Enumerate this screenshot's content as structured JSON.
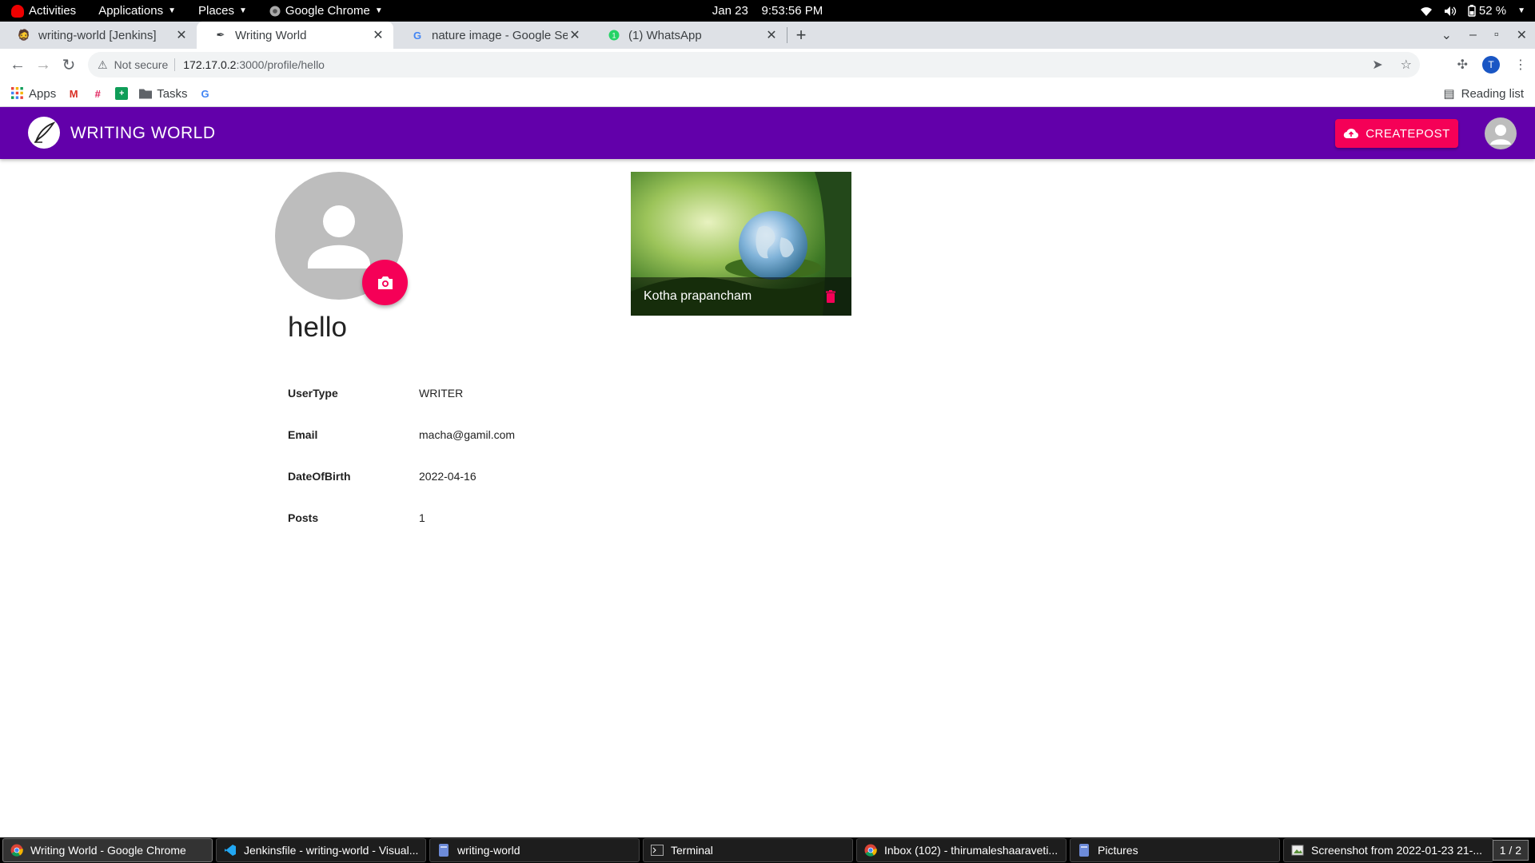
{
  "system_bar": {
    "activities": "Activities",
    "applications": "Applications",
    "places": "Places",
    "app_menu": "Google Chrome",
    "date": "Jan 23",
    "time": "9:53:56 PM",
    "battery": "52 %"
  },
  "browser": {
    "tabs": [
      {
        "title": "writing-world [Jenkins]",
        "icon": "jenkins-icon",
        "active": false
      },
      {
        "title": "Writing World",
        "icon": "quill-icon",
        "active": true
      },
      {
        "title": "nature image - Google Sea",
        "icon": "google-icon",
        "active": false
      },
      {
        "title": "(1) WhatsApp",
        "icon": "whatsapp-icon",
        "active": false
      }
    ],
    "security": "Not secure",
    "url_host": "172.17.0.2",
    "url_path": ":3000/profile/hello",
    "profile_initial": "T",
    "bookmarks": [
      {
        "label": "Apps",
        "icon": "apps-grid-icon"
      },
      {
        "label": "",
        "icon": "gmail-icon"
      },
      {
        "label": "",
        "icon": "slack-icon"
      },
      {
        "label": "",
        "icon": "sheets-icon"
      },
      {
        "label": "Tasks",
        "icon": "folder-icon"
      },
      {
        "label": "",
        "icon": "google-icon"
      }
    ],
    "reading_list": "Reading list"
  },
  "app": {
    "title": "WRITING WORLD",
    "create_post": "CREATEPOST",
    "brand_color": "#6200aa",
    "accent_color": "#f50057"
  },
  "profile": {
    "username": "hello",
    "fields": [
      {
        "key": "UserType",
        "value": "WRITER"
      },
      {
        "key": "Email",
        "value": "macha@gamil.com"
      },
      {
        "key": "DateOfBirth",
        "value": "2022-04-16"
      },
      {
        "key": "Posts",
        "value": "1"
      }
    ]
  },
  "posts": [
    {
      "title": "Kotha prapancham"
    }
  ],
  "taskbar": {
    "items": [
      {
        "label": "Writing World - Google Chrome",
        "icon": "chrome-icon",
        "active": true
      },
      {
        "label": "Jenkinsfile - writing-world - Visual...",
        "icon": "vscode-icon",
        "active": false
      },
      {
        "label": "writing-world",
        "icon": "files-icon",
        "active": false
      },
      {
        "label": "Terminal",
        "icon": "terminal-icon",
        "active": false
      },
      {
        "label": "Inbox (102) - thirumaleshaaraveti...",
        "icon": "chrome-icon",
        "active": false
      },
      {
        "label": "Pictures",
        "icon": "files-icon",
        "active": false
      },
      {
        "label": "Screenshot from 2022-01-23 21-...",
        "icon": "image-viewer-icon",
        "active": false
      }
    ],
    "workspace": "1 / 2"
  }
}
